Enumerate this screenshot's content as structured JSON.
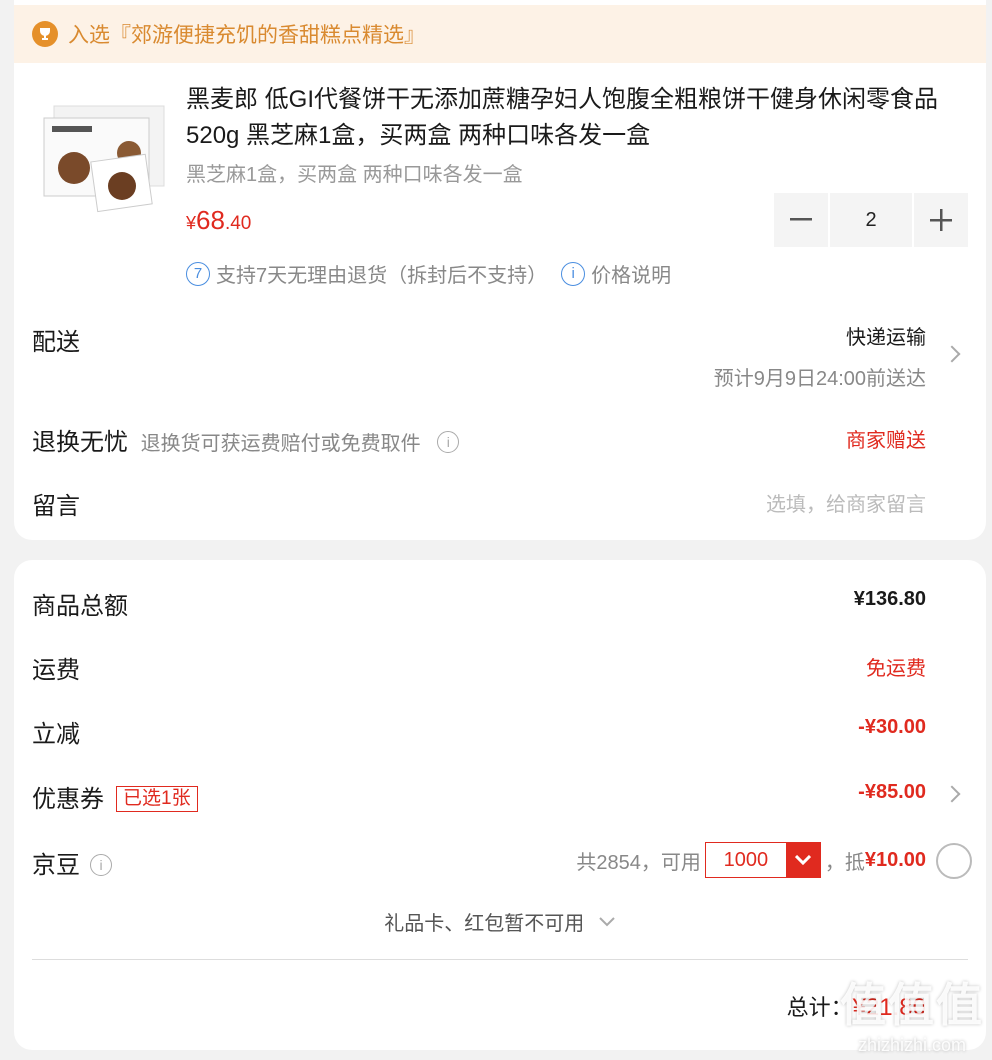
{
  "banner": {
    "text": "入选『郊游便捷充饥的香甜糕点精选』",
    "icon": "trophy-icon"
  },
  "product": {
    "title": "黑麦郎 低GI代餐饼干无添加蔗糖孕妇人饱腹全粗粮饼干健身休闲零食品520g 黑芝麻1盒，买两盒 两种口味各发一盒",
    "spec": "黑芝麻1盒，买两盒 两种口味各发一盒",
    "price_symbol": "¥",
    "price_int": "68",
    "price_dec": ".40",
    "quantity": "2",
    "support_badge": "7",
    "support_text": "支持7天无理由退货（拆封后不支持）",
    "price_note_badge": "i",
    "price_note": "价格说明"
  },
  "delivery": {
    "label": "配送",
    "method": "快递运输",
    "eta": "预计9月9日24:00前送达"
  },
  "returns": {
    "label": "退换无忧",
    "desc": "退换货可获运费赔付或免费取件",
    "badge": "商家赠送"
  },
  "message": {
    "label": "留言",
    "placeholder": "选填，给商家留言"
  },
  "summary": {
    "subtotal_label": "商品总额",
    "subtotal": "¥136.80",
    "shipping_label": "运费",
    "shipping": "免运费",
    "discount_label": "立减",
    "discount": "-¥30.00",
    "coupon_label": "优惠券",
    "coupon_tag": "已选1张",
    "coupon": "-¥85.00",
    "beans_label": "京豆",
    "beans_total": "共2854，可用",
    "beans_use": "1000",
    "beans_sep": "，抵",
    "beans_value": "¥10.00",
    "gift_note": "礼品卡、红包暂不可用",
    "total_label": "总计：",
    "total": "¥21.80"
  },
  "watermark": {
    "main": "值值值",
    "sub": "zhizhizhi.com"
  },
  "colors": {
    "accent": "#e02a1f",
    "banner_bg": "#fdf2e6",
    "banner_text": "#d98a30",
    "link": "#4a8ee0"
  }
}
